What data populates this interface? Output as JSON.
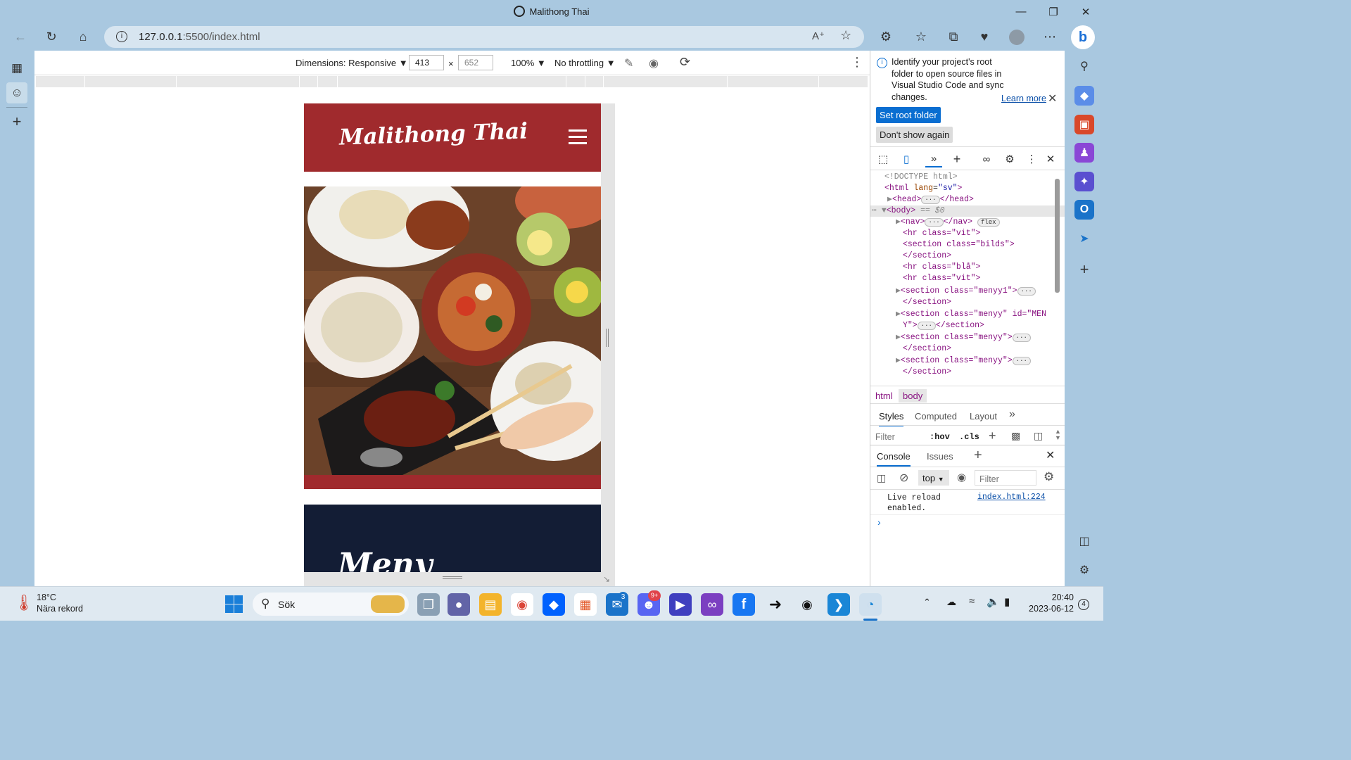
{
  "window": {
    "title": "Malithong Thai",
    "minimize_icon": "minimize-icon",
    "maximize_icon": "restore-icon",
    "close_icon": "close-icon"
  },
  "toolbar": {
    "url": "127.0.0.1:5500/index.html",
    "url_host": "127.0.0.1",
    "url_rest": ":5500/index.html"
  },
  "device_toolbar": {
    "dimensions_label": "Dimensions: Responsive",
    "width": "413",
    "times": "×",
    "height": "652",
    "zoom": "100%",
    "throttling": "No throttling"
  },
  "page": {
    "logo": "Malithong Thai",
    "menu_heading": "Meny",
    "colors": {
      "header": "#a02a2d",
      "menu_bg": "#131d35"
    }
  },
  "devtools": {
    "info_message": "Identify your project's root folder to open source files in Visual Studio Code and sync changes.",
    "learn_more": "Learn more",
    "set_root_button": "Set root folder",
    "dont_show_button": "Don't show again",
    "dom": {
      "doctype": "<!DOCTYPE html>",
      "html_open": "<html",
      "html_lang_attr": "lang",
      "html_lang_val": "\"sv\"",
      "head_open": "<head>",
      "head_close": "</head>",
      "body_open": "<body>",
      "body_eq": "== $0",
      "nav_open": "<nav>",
      "nav_close": "</nav>",
      "flex_badge": "flex",
      "hr_vit": "<hr class=\"vit\">",
      "section_bilds": "<section class=\"bilds\">",
      "section_close": "</section>",
      "hr_bla": "<hr class=\"blå\">",
      "hr_vit2": "<hr class=\"vit\">",
      "section_menyy1": "<section class=\"menyy1\">",
      "section_menyy_id_1": "<section class=\"menyy\" id=\"MEN",
      "section_menyy_id_2": "Y\">",
      "section_menyy": "<section class=\"menyy\">",
      "ellipsis": "···"
    },
    "breadcrumbs": [
      "html",
      "body"
    ],
    "styles_tabs": [
      "Styles",
      "Computed",
      "Layout"
    ],
    "filter_placeholder": "Filter",
    "hov": ":hov",
    "cls": ".cls",
    "drawer_tabs": [
      "Console",
      "Issues"
    ],
    "context": "top",
    "console_filter": "Filter",
    "console_message": "Live reload enabled.",
    "console_link": "index.html:224",
    "prompt": "›"
  },
  "taskbar": {
    "weather_temp": "18°C",
    "weather_text": "Nära rekord",
    "search_label": "Sök",
    "mail_badge": "3",
    "discord_badge": "9+",
    "time": "20:40",
    "date": "2023-06-12",
    "notification_count": "4"
  }
}
